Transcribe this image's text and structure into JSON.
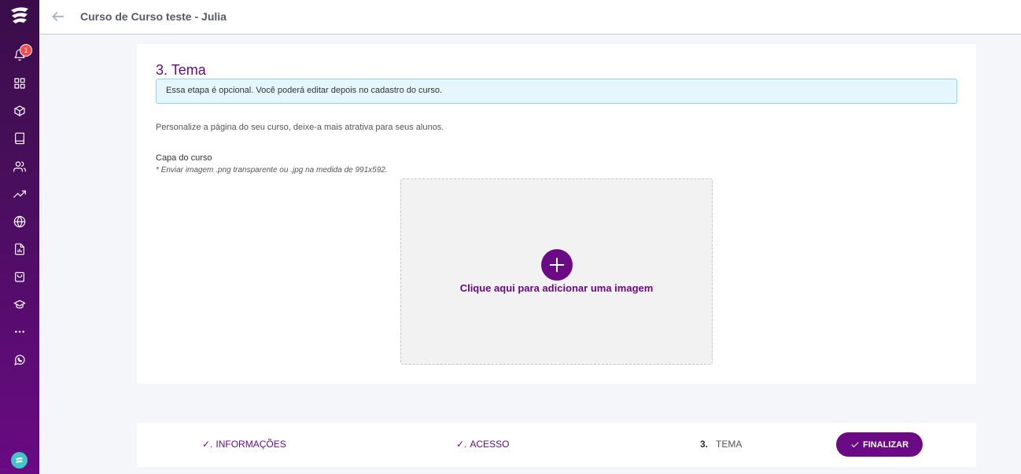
{
  "header": {
    "title": "Curso de Curso teste - Julia"
  },
  "sidebar": {
    "notifications_count": "1",
    "items": [
      {
        "icon": "bell-icon"
      },
      {
        "icon": "grid-icon"
      },
      {
        "icon": "box-icon"
      },
      {
        "icon": "book-icon"
      },
      {
        "icon": "users-icon"
      },
      {
        "icon": "trending-up-icon"
      },
      {
        "icon": "globe-icon"
      },
      {
        "icon": "file-chart-icon"
      },
      {
        "icon": "shopping-bag-icon"
      },
      {
        "icon": "graduation-cap-icon"
      },
      {
        "icon": "more-icon"
      },
      {
        "icon": "whatsapp-icon"
      }
    ]
  },
  "main": {
    "step_title": "3. Tema",
    "alert_text": "Essa etapa é opcional. Você poderá editar depois no cadastro do curso.",
    "description": "Personalize a página do seu curso, deixe-a mais atrativa para seus alunos.",
    "cover_label": "Capa do curso",
    "cover_hint": "* Enviar imagem .png transparente ou .jpg na medida de 991x592.",
    "dropzone_text": "Clique aqui para adicionar uma imagem"
  },
  "stepper": {
    "steps": [
      {
        "label": "INFORMAÇÕES",
        "check": "✓."
      },
      {
        "label": "ACESSO",
        "check": "✓."
      },
      {
        "label": "TEMA",
        "number": "3."
      }
    ],
    "finalize_label": "FINALIZAR"
  },
  "colors": {
    "brand": "#6b0a84",
    "alert_bg": "#e6f6fd",
    "badge": "#f24b4b"
  }
}
